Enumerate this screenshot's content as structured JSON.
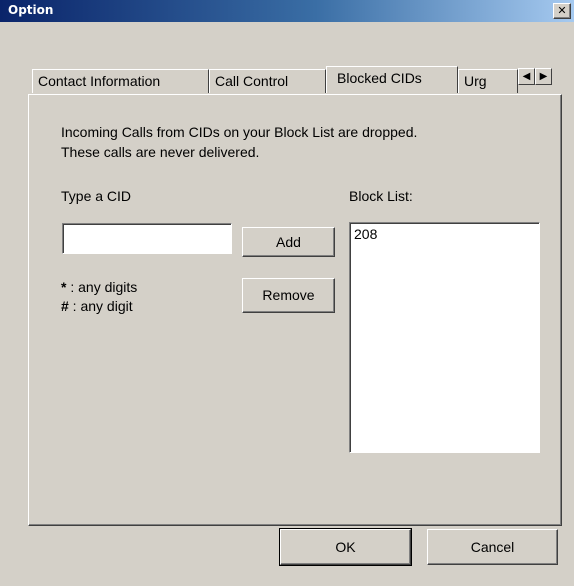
{
  "window": {
    "title": "Option",
    "close_glyph": "✕"
  },
  "tabs": [
    {
      "label": "Contact Information",
      "active": false
    },
    {
      "label": "Call Control",
      "active": false
    },
    {
      "label": "Blocked CIDs",
      "active": true
    },
    {
      "label": "Urg",
      "active": false
    }
  ],
  "tab_scroll": {
    "left_glyph": "◀",
    "right_glyph": "▶"
  },
  "description": {
    "line1": "Incoming Calls from CIDs on your Block List are dropped.",
    "line2": "These calls are never delivered."
  },
  "cid_input": {
    "label": "Type a CID",
    "value": ""
  },
  "buttons": {
    "add": "Add",
    "remove": "Remove",
    "ok": "OK",
    "cancel": "Cancel"
  },
  "hints": [
    {
      "symbol": "*",
      "text": " : any digits"
    },
    {
      "symbol": "#",
      "text": " : any digit"
    }
  ],
  "block_list": {
    "label": "Block List:",
    "items": [
      "208"
    ]
  }
}
